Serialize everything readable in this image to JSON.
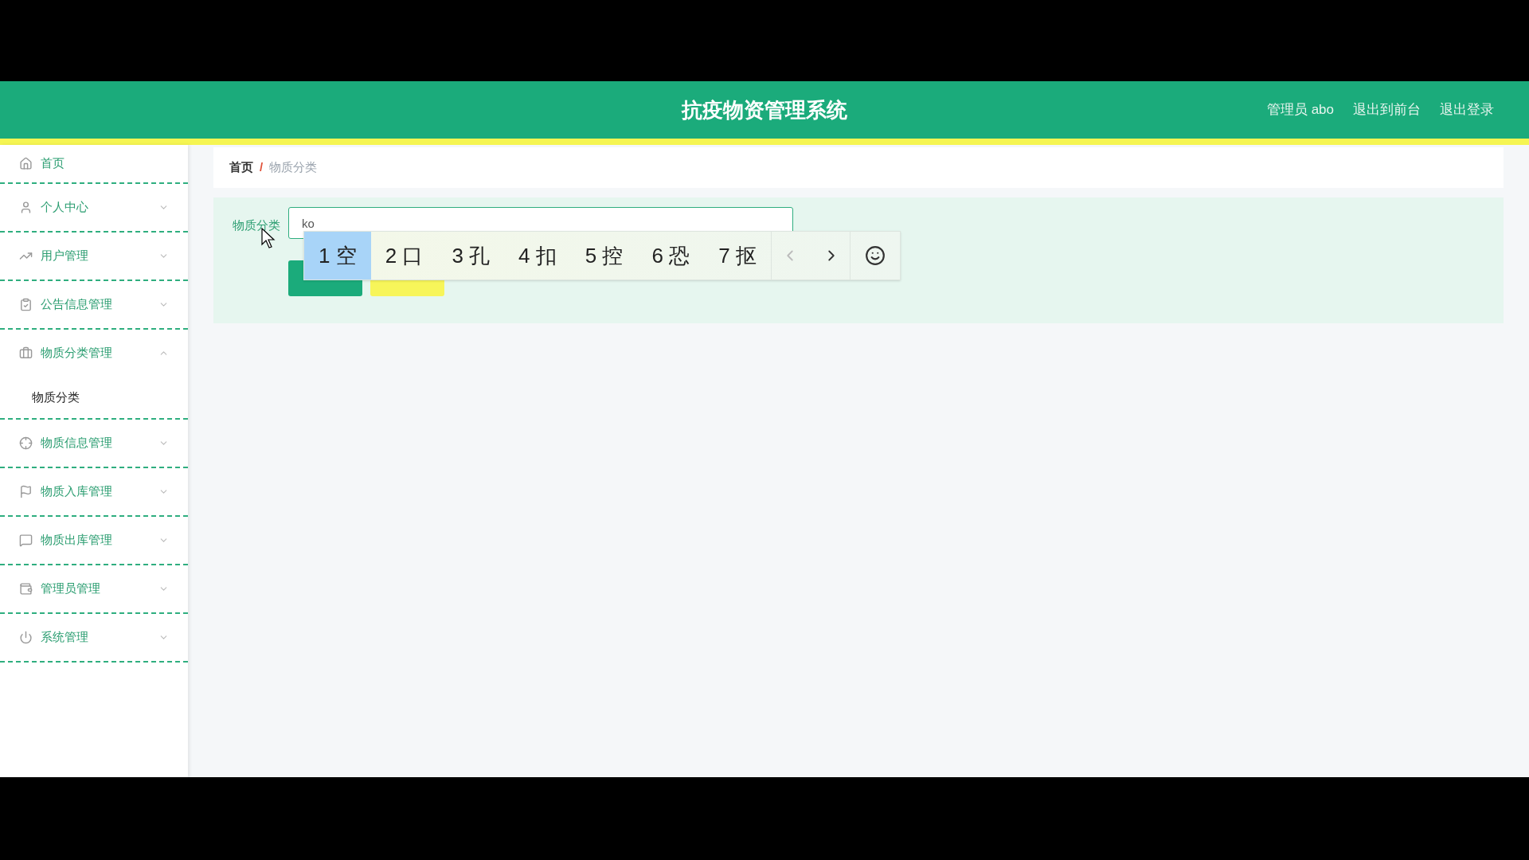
{
  "header": {
    "title": "抗疫物资管理系统",
    "user": "管理员 abo",
    "links": [
      "退出到前台",
      "退出登录"
    ]
  },
  "sidebar": {
    "items": [
      {
        "label": "首页",
        "expandable": false
      },
      {
        "label": "个人中心",
        "expandable": true,
        "expanded": false
      },
      {
        "label": "用户管理",
        "expandable": true,
        "expanded": false
      },
      {
        "label": "公告信息管理",
        "expandable": true,
        "expanded": false
      },
      {
        "label": "物质分类管理",
        "expandable": true,
        "expanded": true,
        "children": [
          {
            "label": "物质分类"
          }
        ]
      },
      {
        "label": "物质信息管理",
        "expandable": true,
        "expanded": false
      },
      {
        "label": "物质入库管理",
        "expandable": true,
        "expanded": false
      },
      {
        "label": "物质出库管理",
        "expandable": true,
        "expanded": false
      },
      {
        "label": "管理员管理",
        "expandable": true,
        "expanded": false
      },
      {
        "label": "系统管理",
        "expandable": true,
        "expanded": false
      }
    ]
  },
  "breadcrumb": [
    {
      "label": "首页",
      "selected": false
    },
    {
      "label": "物质分类",
      "selected": true
    }
  ],
  "breadcrumb_separator": "/",
  "form": {
    "label": "物质分类",
    "value": "ko",
    "buttons": [
      {
        "kind": "primary"
      },
      {
        "kind": "warning"
      }
    ]
  },
  "ime": {
    "candidates": [
      {
        "label": "1 空",
        "selected": true
      },
      {
        "label": "2 口",
        "selected": false
      },
      {
        "label": "3 孔",
        "selected": false
      },
      {
        "label": "4 扣",
        "selected": false
      },
      {
        "label": "5 控",
        "selected": false
      },
      {
        "label": "6 恐",
        "selected": false
      },
      {
        "label": "7 抠",
        "selected": false
      }
    ]
  }
}
